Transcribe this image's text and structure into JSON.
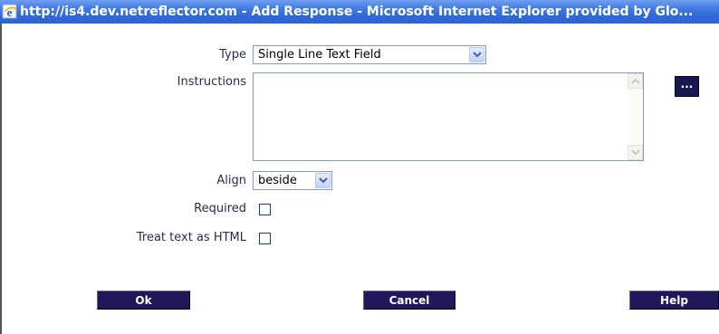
{
  "window": {
    "title": "http://is4.dev.netreflector.com - Add Response - Microsoft Internet Explorer provided by Glo..."
  },
  "form": {
    "type": {
      "label": "Type",
      "value": "Single Line Text Field"
    },
    "instructions": {
      "label": "Instructions",
      "value": "",
      "browse_button_label": "..."
    },
    "align": {
      "label": "Align",
      "value": "beside"
    },
    "required": {
      "label": "Required",
      "checked": false
    },
    "treat_html": {
      "label": "Treat text as HTML",
      "checked": false
    }
  },
  "buttons": {
    "ok": "Ok",
    "cancel": "Cancel",
    "help": "Help"
  },
  "colors": {
    "titlebar": "#3168d8",
    "label_text": "#2a2a55",
    "button_bg": "#20185a",
    "input_border": "#7f9db9"
  },
  "icons": {
    "title_icon": "ie-icon",
    "dropdown": "chevron-down-icon",
    "scroll_up": "chevron-up-icon",
    "scroll_down": "chevron-down-icon"
  }
}
